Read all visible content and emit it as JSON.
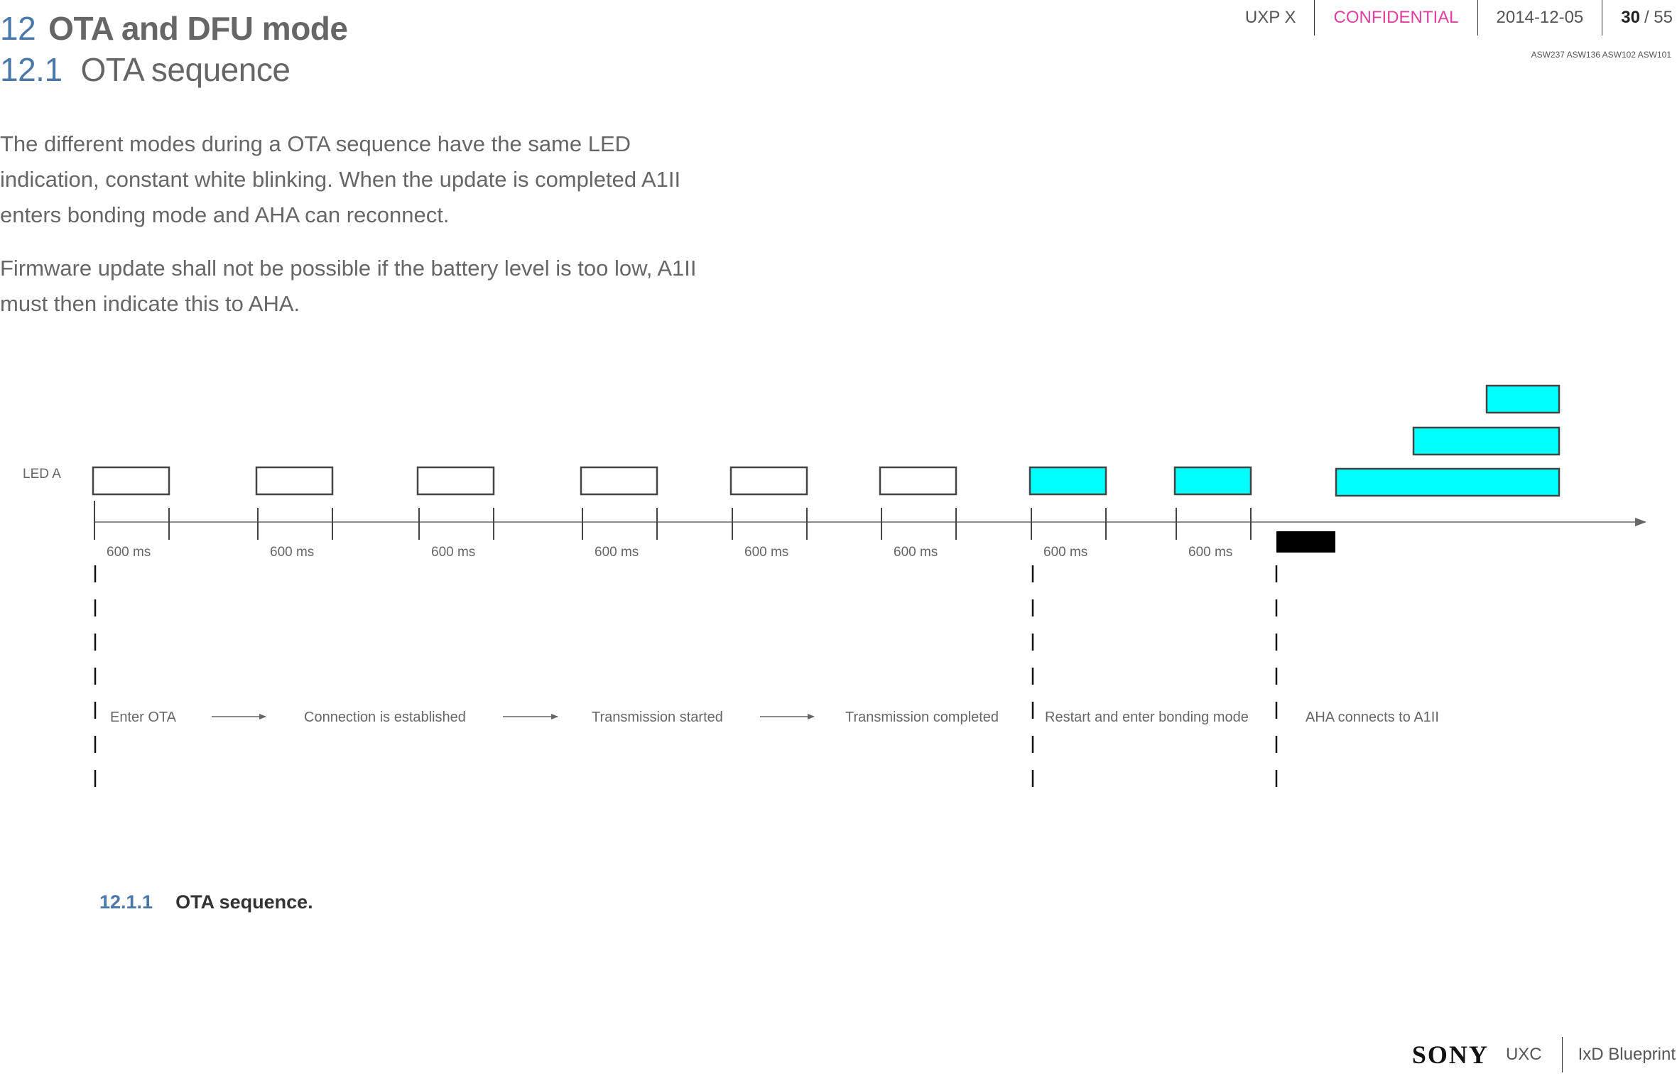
{
  "header": {
    "chapter_number": "12",
    "chapter_title": "OTA and DFU mode",
    "section_number": "12.1",
    "section_title": "OTA sequence",
    "meta": {
      "project": "UXP X",
      "classification": "CONFIDENTIAL",
      "date": "2014-12-05",
      "page_current": "30",
      "page_separator": "/ 55"
    },
    "requirement_ids": "ASW237 ASW136 ASW102 ASW101"
  },
  "body": {
    "paragraphs": [
      "The different modes during a OTA sequence have the same LED indication, constant white blinking. When the update is completed A1II enters bonding mode and AHA can reconnect.",
      "Firmware update shall not be possible if the battery level is too low, A1II must then indicate this to AHA."
    ]
  },
  "diagram": {
    "led_label": "LED A",
    "colors": {
      "off_fill": "#ffffff",
      "on_fill": "#00ffff",
      "stroke": "#444444",
      "marker": "#000000",
      "axis": "#666666"
    },
    "pulses": [
      {
        "state": "white",
        "duration_label": "600 ms"
      },
      {
        "state": "white",
        "duration_label": "600 ms"
      },
      {
        "state": "white",
        "duration_label": "600 ms"
      },
      {
        "state": "white",
        "duration_label": "600 ms"
      },
      {
        "state": "white",
        "duration_label": "600 ms"
      },
      {
        "state": "white",
        "duration_label": "600 ms"
      },
      {
        "state": "cyan",
        "duration_label": "600 ms"
      },
      {
        "state": "cyan",
        "duration_label": "600 ms"
      }
    ],
    "stacked_bars": [
      {
        "state": "cyan",
        "level": 1
      },
      {
        "state": "cyan",
        "level": 2
      },
      {
        "state": "cyan",
        "level": 3
      }
    ],
    "phases": [
      {
        "label": "Enter OTA",
        "arrow_after": true
      },
      {
        "label": "Connection is established",
        "arrow_after": true
      },
      {
        "label": "Transmission started",
        "arrow_after": true
      },
      {
        "label": "Transmission completed",
        "arrow_after": false
      },
      {
        "label": "Restart and enter bonding mode",
        "arrow_after": false
      },
      {
        "label": "AHA connects to A1II",
        "arrow_after": false
      }
    ]
  },
  "caption": {
    "number": "12.1.1",
    "title": "OTA sequence."
  },
  "footer": {
    "brand": "SONY",
    "unit": "UXC",
    "document": "IxD Blueprint"
  }
}
